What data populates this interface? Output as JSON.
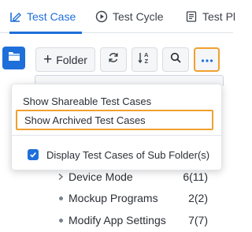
{
  "tabs": [
    {
      "label": "Test Case",
      "icon": "test-case-icon",
      "active": true
    },
    {
      "label": "Test Cycle",
      "icon": "play-circle-icon",
      "active": false
    },
    {
      "label": "Test Pl",
      "icon": "document-icon",
      "active": false
    }
  ],
  "toolbar": {
    "folder_label": "Folder",
    "refresh_icon": "refresh-icon",
    "sort_icon": "sort-az-icon",
    "search_icon": "search-icon",
    "more_icon": "more-horizontal-icon"
  },
  "rail": {
    "icon": "folder-icon"
  },
  "menu": {
    "shareable": "Show Shareable Test Cases",
    "archived": "Show Archived Test Cases",
    "subfolder": "Display Test Cases of Sub Folder(s)",
    "subfolder_checked": true
  },
  "rows": [
    {
      "marker": "chevron",
      "label": "Device Mode",
      "count": "6(11)"
    },
    {
      "marker": "dot",
      "label": "Mockup Programs",
      "count": "2(2)"
    },
    {
      "marker": "dot",
      "label": "Modify App Settings",
      "count": "7(7)"
    }
  ],
  "colors": {
    "accent": "#1e6fd9",
    "highlight": "#f0a030"
  }
}
